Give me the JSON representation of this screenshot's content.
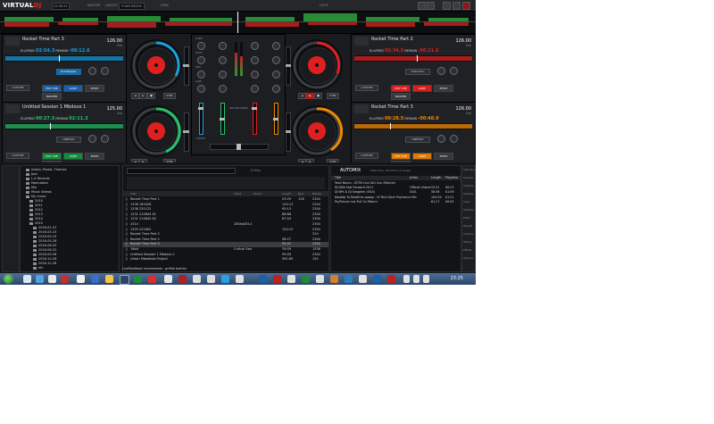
{
  "app": {
    "logo_a": "VIRTUAL",
    "logo_b": "DJ",
    "clock": "02:30:21",
    "layout_label": "LAYOUT",
    "layout_value": "FOUR DECKS",
    "master_label": "MASTER",
    "lists_label": "LISTS",
    "timing_label": "SYNC"
  },
  "decks": [
    {
      "title": "Rocket Time Part 3",
      "artist": "",
      "bpm": "126.00",
      "key": "Gm",
      "elapsed_label": "ELAPSED",
      "elapsed": "02:54.3",
      "remain_label": "REMAIN",
      "remain": "-00:12.6",
      "color": "#1aa0e0",
      "side": "left",
      "row": 0,
      "effect": "EchoDopler",
      "custom": "CUSTOM",
      "pads": [
        "HOT CUE",
        "LOOP",
        "PITCH",
        "MASTER"
      ]
    },
    {
      "title": "Rocket Time Part 2",
      "artist": "",
      "bpm": "126.00",
      "key": "Gm",
      "elapsed_label": "ELAPSED",
      "elapsed": "02:34.5",
      "remain_label": "REMAIN",
      "remain": "-00:21.6",
      "color": "#e02020",
      "side": "right",
      "row": 0,
      "effect": "Distortion",
      "custom": "CUSTOM",
      "pads": [
        "HOT CUE",
        "LOOP",
        "PITCH",
        "MASTER"
      ]
    },
    {
      "title": "Untitled Session 1 Mbdovo 1",
      "artist": "",
      "bpm": "125.00",
      "key": "Am",
      "elapsed_label": "ELAPSED",
      "elapsed": "00:27.5",
      "remain_label": "REMAIN",
      "remain": "02:11.3",
      "color": "#23c46a",
      "side": "left",
      "row": 1,
      "effect": "LINEVOC",
      "custom": "CUSTOM",
      "pads": [
        "HOT CUE",
        "LOOP",
        "PITCH",
        "MASTER"
      ]
    },
    {
      "title": "Rocket Time Part 3",
      "artist": "",
      "bpm": "126.00",
      "key": "Gm",
      "elapsed_label": "ELAPSED",
      "elapsed": "00:28.5",
      "remain_label": "REMAIN",
      "remain": "-00:48.9",
      "color": "#f08a00",
      "side": "right",
      "row": 1,
      "effect": "LINEVOC",
      "custom": "CUSTOM",
      "pads": [
        "HOT CUE",
        "LOOP",
        "PITCH",
        "MASTER"
      ]
    }
  ],
  "mixer": {
    "gain": "GAIN",
    "high": "HIGH",
    "mid": "MID",
    "low": "LOW",
    "filter": "FILTER",
    "headphone": "HEADPHONES",
    "master": "MASTER",
    "crossfader": "CROSSFADER"
  },
  "folders": {
    "items": [
      "Indian, Posed, Themes",
      "Jazz",
      "L.A Records",
      "Manhattan",
      "Mix",
      "Music Videos",
      "My music",
      "2010",
      "2011",
      "2012",
      "2013",
      "2014",
      "2015",
      "2016-01-31",
      "2016-03-13",
      "2016-05-15",
      "2016-05-26",
      "2016-06-03",
      "2016-08-22",
      "2016-09-28",
      "2016-10-26",
      "2016-12-28",
      "etc"
    ]
  },
  "tracks": {
    "toolbar": "13 files",
    "columns": [
      "Title",
      "Artist",
      "Remix",
      "Length",
      "Bpm",
      "Bitrate"
    ],
    "rows": [
      {
        "title": "Rocket Time Part 1",
        "artist": "",
        "remix": "",
        "length": "03:29",
        "bpm": "126",
        "bitrate": "2304"
      },
      {
        "title": "1238 183426",
        "artist": "",
        "remix": "",
        "length": "124:13",
        "bpm": "",
        "bitrate": "2304"
      },
      {
        "title": "1238 231122",
        "artist": "",
        "remix": "",
        "length": "95:13",
        "bpm": "",
        "bitrate": "2304"
      },
      {
        "title": "1231 214845 81",
        "artist": "",
        "remix": "",
        "length": "88:68",
        "bpm": "",
        "bitrate": "2304"
      },
      {
        "title": "1231 214845 82",
        "artist": "",
        "remix": "",
        "length": "87:04",
        "bpm": "",
        "bitrate": "2304"
      },
      {
        "title": "2014",
        "artist": "280ed2814",
        "remix": "",
        "length": "",
        "bpm": "",
        "bitrate": "2304"
      },
      {
        "title": "1329 221600",
        "artist": "",
        "remix": "",
        "length": "124:13",
        "bpm": "",
        "bitrate": "2304"
      },
      {
        "title": "Rocket Time Part 2",
        "artist": "",
        "remix": "",
        "length": "",
        "bpm": "",
        "bitrate": "224"
      },
      {
        "title": "Rocket Time Part 2",
        "artist": "",
        "remix": "",
        "length": "98:27",
        "bpm": "",
        "bitrate": "2304"
      },
      {
        "title": "Rocket Time Part 3",
        "artist": "",
        "remix": "",
        "length": "93:47",
        "bpm": "",
        "bitrate": "2304"
      },
      {
        "title": "16bit",
        "artist": "Critical Sea",
        "remix": "",
        "length": "39:59",
        "bpm": "",
        "bitrate": "1536"
      },
      {
        "title": "Untitled Session 1 Mbdovo 1",
        "artist": "",
        "remix": "",
        "length": "99:05",
        "bpm": "",
        "bitrate": "2304"
      },
      {
        "title": "Urban Mbodeblo Project",
        "artist": "",
        "remix": "",
        "length": "561:85",
        "bpm": "",
        "bitrate": "192"
      }
    ],
    "selected_index": 9,
    "status": "LiveFeedback recommends : gritfile brother"
  },
  "automix": {
    "title": "AUTOMIX",
    "info": "Total time: 01:03:52 (3 songs)",
    "columns": [
      "Title",
      "Artist",
      "Length",
      "Playtime"
    ],
    "rows": [
      {
        "title": "Yeah Neuro - EETM Live 001 Sun Elliot/ctr",
        "artist": "",
        "length": "",
        "playtime": ""
      },
      {
        "title": "DJ DNA Fast Forward 2011",
        "artist": "Official Videos",
        "length": "52:51",
        "playtime": "00:23"
      },
      {
        "title": "DJ NPs & DJ Seaglem (OIDi)",
        "artist": "GOA",
        "length": "58:38",
        "playtime": "01:09"
      },
      {
        "title": "Nadalia To Realtime ooapp - Hi Tech Dark Psytrance Mix",
        "artist": "",
        "length": "104:59",
        "playtime": "01:21"
      },
      {
        "title": "PsyTrance mix Full On Mtorm",
        "artist": "",
        "length": "61:17",
        "playtime": "00:03"
      }
    ]
  },
  "right_strip": [
    "Sideview",
    "Sampler",
    "Automix",
    "Karaoke",
    "Clone",
    "Sandbox",
    "Editor",
    "Playlist",
    "Automix",
    "History",
    "Effects",
    "Options"
  ],
  "taskbar": {
    "clock": "23:25"
  }
}
